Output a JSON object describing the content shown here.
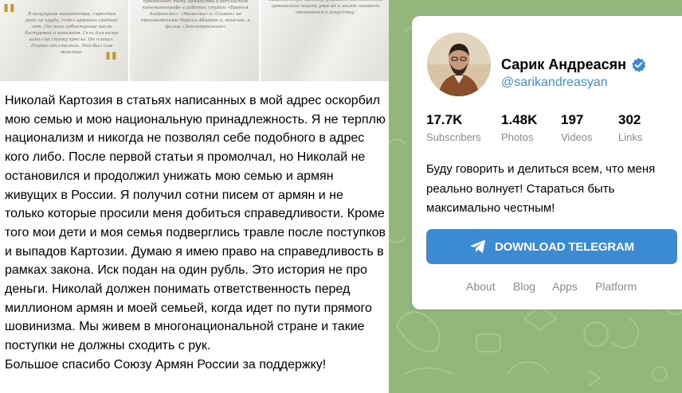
{
  "post": {
    "thumb1_text": "В полумраке кинотеатра, скрестив руки на груди, сидел армянин средних лет. От него ипбиктующе пахло бастурмой и коньяком. Гель для волос капал на спинку кресла. Он плакал. Плакал от счастья. Это был сам маэстро.",
    "thumb2_text": "продвигает тему армянства в российском кинематографе в работах студии «Братья Андреасян»: «Мамочки» и «Симон» по произведениям Наринэ Абгарян и, конечно, в фильм «Землетрясение»",
    "thumb3_text": "национальную вражду, унижает достоинства армянского народа уже не и несет никакого отношения к искусству.",
    "text": "Николай Картозия в статьях написанных в мой адрес оскорбил мою семью и мою национальную принадлежность. Я не терплю национализм и никогда не позволял себе подобного в адрес кого либо. После первой статьи я промолчал, но Николай не остановился и продолжил унижать мою семью и армян живущих в России. Я получил сотни писем от армян и не только которые просили меня добиться справедливости. Кроме того мои дети и моя семья подверглись травле после поступков и выпадов Картозии. Думаю я имею право на справедливость в рамках закона. Иск подан на один рубль. Это история не про деньги. Николай должен понимать ответственность перед миллионом армян и моей семьей, когда идет по пути прямого шовинизма. Мы живем в многонациональной стране и такие поступки не должны сходить с рук.\nБольшое спасибо Союзу Армян России за поддержку!"
  },
  "channel": {
    "name": "Сарик Андреасян",
    "handle": "@sarikandreasyan",
    "verified_icon": "verified-badge-icon",
    "stats": [
      {
        "value": "17.7K",
        "label": "Subscribers"
      },
      {
        "value": "1.48K",
        "label": "Photos"
      },
      {
        "value": "197",
        "label": "Videos"
      },
      {
        "value": "302",
        "label": "Links"
      }
    ],
    "description": "Буду говорить и делиться всем, что меня реально волнует! Стараться быть максимально честным!",
    "download_label": "DOWNLOAD TELEGRAM",
    "footer_links": [
      "About",
      "Blog",
      "Apps",
      "Platform"
    ]
  },
  "colors": {
    "accent": "#3a8bd3",
    "link": "#3d8fd4",
    "background": "#93b67d"
  }
}
